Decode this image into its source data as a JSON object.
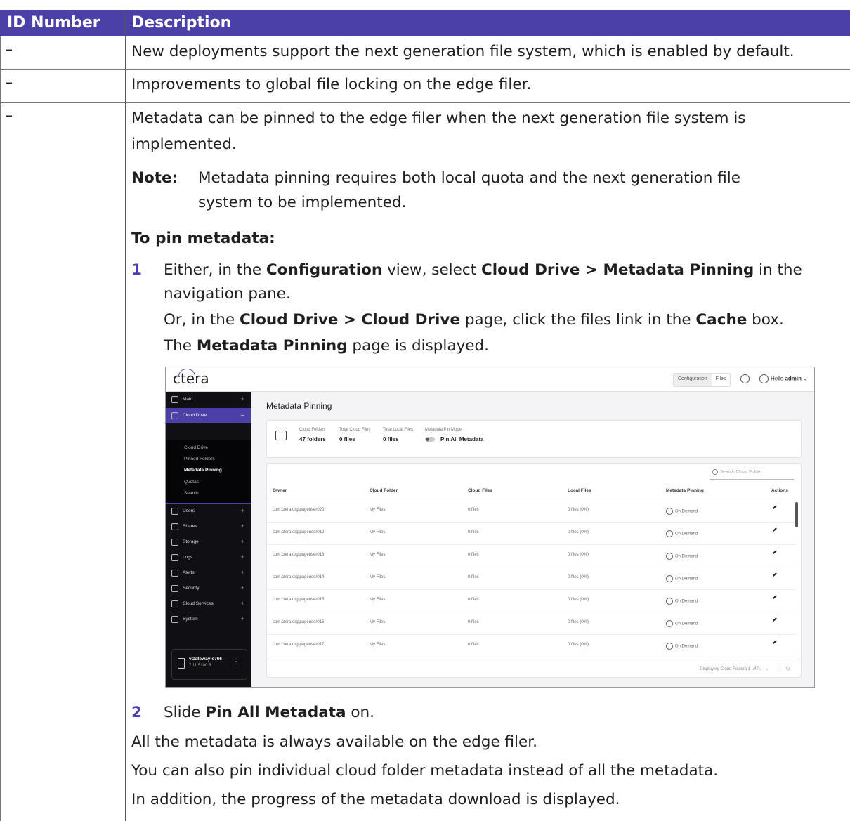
{
  "table": {
    "headers": [
      "ID Number",
      "Description"
    ],
    "rows": [
      {
        "id": "–",
        "description": "New deployments support the next generation file system, which is enabled by default."
      },
      {
        "id": "–",
        "description": "Improvements to global file locking on the edge filer."
      },
      {
        "id": "–"
      }
    ]
  },
  "row3": {
    "intro_line1": "Metadata can be pinned to the edge filer when the next generation file system is",
    "intro_line2": "implemented.",
    "note_label": "Note:",
    "note_line1": "Metadata pinning requires both local quota and the next generation file",
    "note_line2": "system to be implemented.",
    "procedure_heading": "To pin metadata:",
    "steps": [
      {
        "number": "1",
        "l1a": "Either, in the ",
        "l1b": "Configuration",
        "l1c": " view, select ",
        "l1d": "Cloud Drive > Metadata Pinning",
        "l1e": " in the",
        "l2": "navigation pane.",
        "l3a": "Or, in the ",
        "l3b": "Cloud Drive > Cloud Drive",
        "l3c": " page, click the files link in the ",
        "l3d": "Cache",
        "l3e": " box.",
        "l4a": "The ",
        "l4b": "Metadata Pinning",
        "l4c": " page is displayed."
      },
      {
        "number": "2",
        "a": "Slide ",
        "b": "Pin All Metadata",
        "c": " on."
      }
    ],
    "after": [
      "All the metadata is always available on the edge filer.",
      "You can also pin individual cloud folder metadata instead of all the metadata.",
      "In addition, the progress of the metadata download is displayed."
    ]
  },
  "shot": {
    "logo": "ctera",
    "tabs": [
      "Configuration",
      "Files"
    ],
    "hello": "Hello",
    "user": "admin",
    "sidebar": [
      "Main",
      "Cloud Drive",
      "Users",
      "Shares",
      "Storage",
      "Logs",
      "Alerts",
      "Security",
      "Cloud Services",
      "System"
    ],
    "submenu": [
      "Cloud Drive",
      "Pinned Folders",
      "Metadata Pinning",
      "Quotas",
      "Search"
    ],
    "device": {
      "name": "vGateway-e766",
      "version": "7.11.5100.5"
    },
    "title": "Metadata Pinning",
    "stats": [
      {
        "label": "Cloud Folders",
        "value": "47 folders"
      },
      {
        "label": "Total Cloud Files",
        "value": "0 files"
      },
      {
        "label": "Total Local Files",
        "value": "0 files"
      },
      {
        "label": "Metadata Pin Mode",
        "value": "Pin All Metadata"
      }
    ],
    "search_placeholder": "Search Cloud Folder",
    "columns": [
      "Owner",
      "Cloud Folder",
      "Cloud Files",
      "Local Files",
      "Metadata Pinning",
      "Actions"
    ],
    "rows": [
      [
        "com.ctera.org\\pageuser020",
        "My Files",
        "0 files",
        "0 files (0%)",
        "On Demand"
      ],
      [
        "com.ctera.org\\pageuser012",
        "My Files",
        "0 files",
        "0 files (0%)",
        "On Demand"
      ],
      [
        "com.ctera.org\\pageuser013",
        "My Files",
        "0 files",
        "0 files (0%)",
        "On Demand"
      ],
      [
        "com.ctera.org\\pageuser014",
        "My Files",
        "0 files",
        "0 files (0%)",
        "On Demand"
      ],
      [
        "com.ctera.org\\pageuser015",
        "My Files",
        "0 files",
        "0 files (0%)",
        "On Demand"
      ],
      [
        "com.ctera.org\\pageuser016",
        "My Files",
        "0 files",
        "0 files (0%)",
        "On Demand"
      ],
      [
        "com.ctera.org\\pageuser017",
        "My Files",
        "0 files",
        "0 files (0%)",
        "On Demand"
      ]
    ],
    "pager": "Displaying Cloud Folders 1 - 47"
  }
}
